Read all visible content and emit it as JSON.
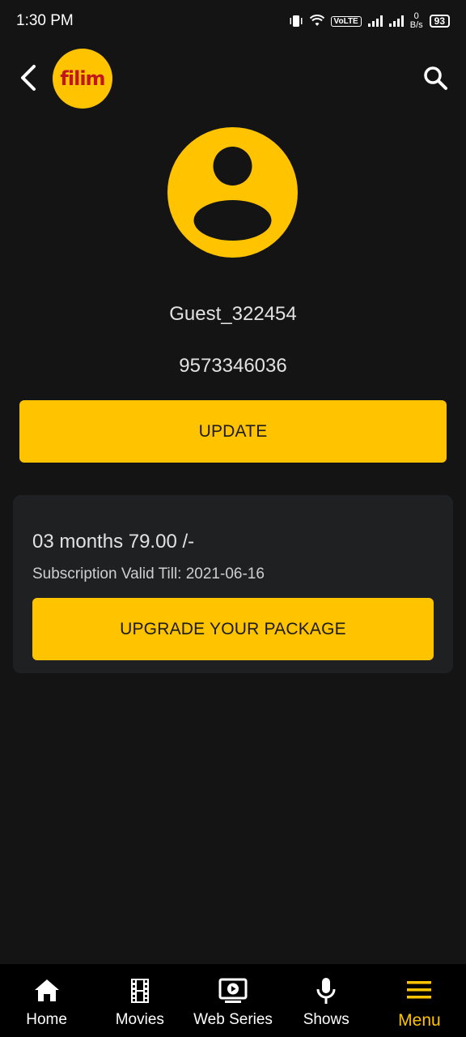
{
  "status_bar": {
    "time": "1:30 PM",
    "volte": "VoLTE",
    "net_speed_value": "0",
    "net_speed_unit": "B/s",
    "battery": "93"
  },
  "header": {
    "logo_text": "filim"
  },
  "profile": {
    "username": "Guest_322454",
    "phone": "9573346036",
    "update_label": "UPDATE"
  },
  "subscription": {
    "plan": "03 months 79.00 /-",
    "valid_till": "Subscription Valid Till: 2021-06-16",
    "upgrade_label": "UPGRADE YOUR PACKAGE"
  },
  "bottom_nav": {
    "items": [
      {
        "label": "Home",
        "icon": "home-icon"
      },
      {
        "label": "Movies",
        "icon": "film-icon"
      },
      {
        "label": "Web Series",
        "icon": "tv-play-icon"
      },
      {
        "label": "Shows",
        "icon": "microphone-icon"
      },
      {
        "label": "Menu",
        "icon": "menu-icon"
      }
    ],
    "active": "Menu"
  },
  "colors": {
    "accent": "#ffc300",
    "background": "#141414",
    "card": "#1e2022",
    "nav_background": "#000000"
  }
}
